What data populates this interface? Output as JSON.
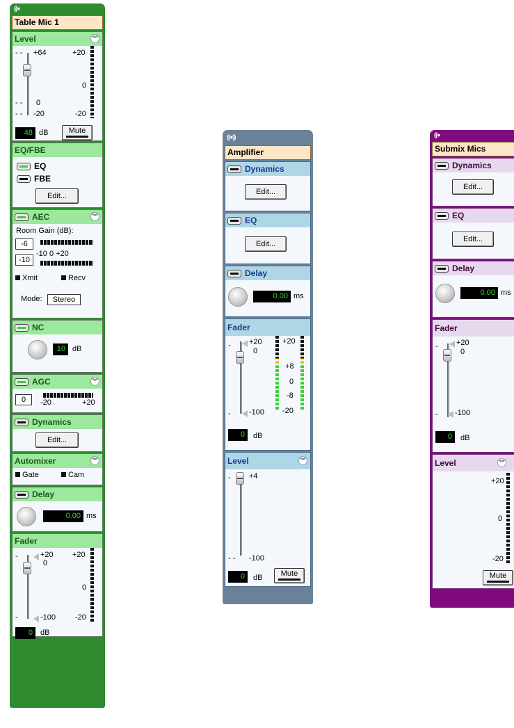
{
  "strip1": {
    "title": "Table Mic 1",
    "level": {
      "header": "Level",
      "marks": [
        "+64",
        "0",
        "-20"
      ],
      "meter_marks": [
        "+20",
        "0",
        "-20"
      ],
      "value": "48",
      "unit": "dB",
      "mute": "Mute"
    },
    "eqfbe": {
      "header": "EQ/FBE",
      "eq": "EQ",
      "fbe": "FBE",
      "edit": "Edit..."
    },
    "aec": {
      "header": "AEC",
      "room_gain": "Room Gain (dB):",
      "box1": "-6",
      "box2": "-10",
      "scale": "-10  0     +20",
      "xmit": "Xmit",
      "recv": "Recv",
      "mode_label": "Mode:",
      "mode_value": "Stereo"
    },
    "nc": {
      "header": "NC",
      "value": "10",
      "unit": "dB"
    },
    "agc": {
      "header": "AGC",
      "box": "0",
      "low": "-20",
      "high": "+20"
    },
    "dynamics": {
      "header": "Dynamics",
      "edit": "Edit..."
    },
    "automixer": {
      "header": "Automixer",
      "gate": "Gate",
      "cam": "Cam"
    },
    "delay": {
      "header": "Delay",
      "value": "0.00",
      "unit": "ms"
    },
    "fader": {
      "header": "Fader",
      "marks": [
        "+20",
        "0",
        "-100"
      ],
      "meter_marks": [
        "+20",
        "0",
        "-20"
      ],
      "value": "0",
      "unit": "dB"
    }
  },
  "strip2": {
    "title": "Amplifier",
    "dynamics": {
      "header": "Dynamics",
      "edit": "Edit..."
    },
    "eq": {
      "header": "EQ",
      "edit": "Edit..."
    },
    "delay": {
      "header": "Delay",
      "value": "0.00",
      "unit": "ms"
    },
    "fader": {
      "header": "Fader",
      "marks": [
        "+20",
        "0",
        "-100"
      ],
      "meter_marks": [
        "+20",
        "+8",
        "0",
        "-8",
        "-20"
      ],
      "value": "0",
      "unit": "dB"
    },
    "level": {
      "header": "Level",
      "marks": [
        "+4",
        "-100"
      ],
      "value": "0",
      "unit": "dB",
      "mute": "Mute"
    }
  },
  "strip3": {
    "title": "Submix Mics",
    "dynamics": {
      "header": "Dynamics",
      "edit": "Edit..."
    },
    "eq": {
      "header": "EQ",
      "edit": "Edit..."
    },
    "delay": {
      "header": "Delay",
      "value": "0.00",
      "unit": "ms"
    },
    "fader": {
      "header": "Fader",
      "marks": [
        "+20",
        "0",
        "-100"
      ],
      "value": "0",
      "unit": "dB"
    },
    "level": {
      "header": "Level",
      "meter_marks": [
        "+20",
        "0",
        "-20"
      ],
      "mute": "Mute"
    }
  },
  "colors": {
    "green": "#2e8b2e",
    "blue": "#6a8199",
    "purple": "#800a80",
    "lcd_text": "#3ccf3c"
  }
}
